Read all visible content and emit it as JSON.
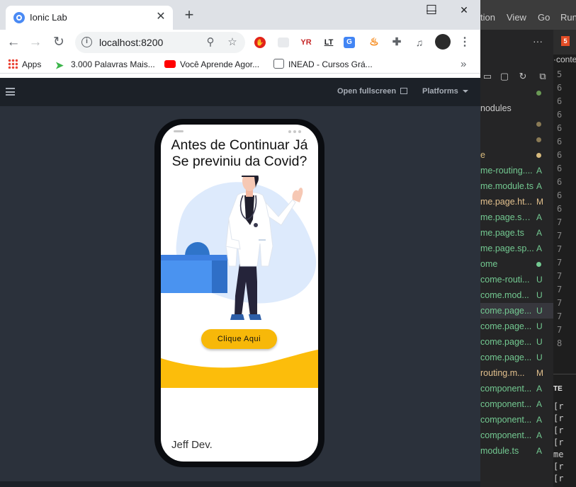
{
  "browser": {
    "tab_title": "Ionic Lab",
    "tab_close": "✕",
    "new_tab": "+",
    "minimize": "—",
    "maximize": "☐",
    "close": "✕",
    "url": "localhost:8200",
    "bookmarks": [
      {
        "label": "Apps"
      },
      {
        "label": "3.000 Palavras Mais..."
      },
      {
        "label": "Você Aprende Agor..."
      },
      {
        "label": "INEAD - Cursos Grá..."
      }
    ],
    "bookmarks_more": "»",
    "extensions": [
      "YR",
      "LT"
    ]
  },
  "lab": {
    "open_fullscreen": "Open fullscreen",
    "platforms": "Platforms"
  },
  "app": {
    "title_line1": "Antes de Continuar Já",
    "title_line2": "Se previniu da Covid?",
    "cta_label": "Clique Aqui",
    "footer": "Jeff Dev.",
    "accent": "#f7b809"
  },
  "editor": {
    "menu": [
      "tion",
      "View",
      "Go",
      "Run"
    ],
    "more": "···",
    "breadcrumb": "·conte",
    "files": [
      {
        "name": "",
        "status": "dot",
        "color": "#6a9955"
      },
      {
        "name": "nodules",
        "status": "",
        "color": "#cccccc"
      },
      {
        "name": "",
        "status": "dot",
        "color": "#8a7a55"
      },
      {
        "name": "",
        "status": "dot",
        "color": "#8a7a55"
      },
      {
        "name": "e",
        "status": "dot",
        "color": "#d7ba7d"
      },
      {
        "name": "me-routing....",
        "status": "A",
        "color": "#73c991"
      },
      {
        "name": "me.module.ts",
        "status": "A",
        "color": "#73c991"
      },
      {
        "name": "me.page.ht...",
        "status": "M",
        "color": "#e2c08d"
      },
      {
        "name": "me.page.scss",
        "status": "A",
        "color": "#73c991"
      },
      {
        "name": "me.page.ts",
        "status": "A",
        "color": "#73c991"
      },
      {
        "name": "me.page.sp...",
        "status": "A",
        "color": "#73c991"
      },
      {
        "name": "ome",
        "status": "dot",
        "color": "#73c991"
      },
      {
        "name": "come-routi...",
        "status": "U",
        "color": "#73c991"
      },
      {
        "name": "come.mod...",
        "status": "U",
        "color": "#73c991"
      },
      {
        "name": "come.page...",
        "status": "U",
        "color": "#73c991"
      },
      {
        "name": "come.page...",
        "status": "U",
        "color": "#73c991"
      },
      {
        "name": "come.page...",
        "status": "U",
        "color": "#73c991"
      },
      {
        "name": "come.page...",
        "status": "U",
        "color": "#73c991"
      },
      {
        "name": "routing.m...",
        "status": "M",
        "color": "#e2c08d"
      },
      {
        "name": "component...",
        "status": "A",
        "color": "#73c991"
      },
      {
        "name": "component...",
        "status": "A",
        "color": "#73c991"
      },
      {
        "name": "component...",
        "status": "A",
        "color": "#73c991"
      },
      {
        "name": "component...",
        "status": "A",
        "color": "#73c991"
      },
      {
        "name": "module.ts",
        "status": "A",
        "color": "#73c991"
      }
    ],
    "line_numbers": [
      "5",
      "6",
      "6",
      "6",
      "6",
      "6",
      "6",
      "6",
      "6",
      "6",
      "6",
      "7",
      "7",
      "7",
      "7",
      "7",
      "7",
      "7",
      "7",
      "7",
      "8"
    ],
    "terminal_title": "TE",
    "terminal_lines": [
      "[r",
      "[r",
      "[r",
      "[r",
      "me",
      "[r",
      "[r"
    ]
  }
}
